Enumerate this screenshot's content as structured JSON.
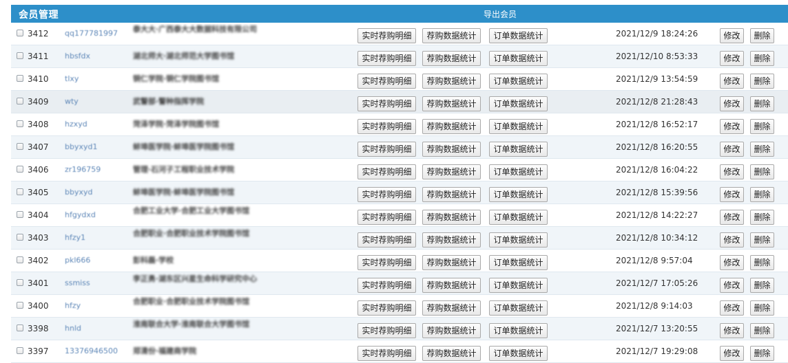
{
  "header": {
    "title": "会员管理",
    "export_label": "导出会员",
    "bg_color": "#2d8fc9"
  },
  "labels": {
    "realtime": "实时荐购明细",
    "stats": "荐购数据统计",
    "orders": "订单数据统计",
    "edit": "修改",
    "delete": "删除"
  },
  "members": [
    {
      "id": "3412",
      "username": "qq177781997",
      "org": "泰大大·广西泰大大数据科技有限公司",
      "time": "2021/12/9 18:24:26"
    },
    {
      "id": "3411",
      "username": "hbsfdx",
      "org": "湖北师大·湖北师范大学图书馆",
      "time": "2021/12/10 8:53:33"
    },
    {
      "id": "3410",
      "username": "tlxy",
      "org": "铜仁学院·铜仁学院图书馆",
      "time": "2021/12/9 13:54:59"
    },
    {
      "id": "3409",
      "username": "wty",
      "org": "武警部·警种指挥学院",
      "time": "2021/12/8 21:28:43"
    },
    {
      "id": "3408",
      "username": "hzxyd",
      "org": "菏泽学院·菏泽学院图书馆",
      "time": "2021/12/8 16:52:17"
    },
    {
      "id": "3407",
      "username": "bbyxyd1",
      "org": "蚌埠医学院·蚌埠医学院图书馆",
      "time": "2021/12/8 16:20:55"
    },
    {
      "id": "3406",
      "username": "zr196759",
      "org": "管理·石河子工程职业技术学院",
      "time": "2021/12/8 16:04:22"
    },
    {
      "id": "3405",
      "username": "bbyxyd",
      "org": "蚌埠医学院·蚌埠医学院图书馆",
      "time": "2021/12/8 15:39:56"
    },
    {
      "id": "3404",
      "username": "hfgydxd",
      "org": "合肥工业大学·合肥工业大学图书馆",
      "time": "2021/12/8 14:22:27"
    },
    {
      "id": "3403",
      "username": "hfzy1",
      "org": "合肥职业·合肥职业技术学院图书馆",
      "time": "2021/12/8 10:34:12"
    },
    {
      "id": "3402",
      "username": "pkl666",
      "org": "彭科磊·学校",
      "time": "2021/12/8 9:57:04"
    },
    {
      "id": "3401",
      "username": "ssmiss",
      "org": "李正勇·湖东区兴星生命科学研究中心",
      "time": "2021/12/7 17:05:26"
    },
    {
      "id": "3400",
      "username": "hfzy",
      "org": "合肥职业·合肥职业技术学院图书馆",
      "time": "2021/12/8 9:14:03"
    },
    {
      "id": "3398",
      "username": "hnld",
      "org": "淮南联合大学·淮南联合大学图书馆",
      "time": "2021/12/7 13:20:55"
    },
    {
      "id": "3397",
      "username": "13376946500",
      "org": "郑清份·福建商学院",
      "time": "2021/12/7 19:29:08"
    }
  ]
}
